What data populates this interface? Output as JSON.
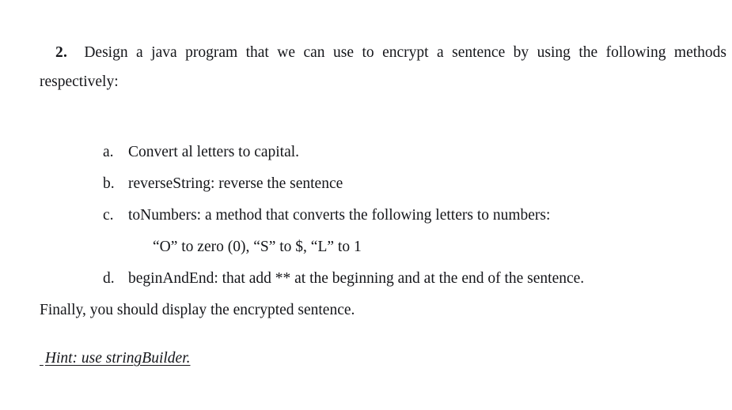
{
  "document": {
    "question_number": "2.",
    "intro": "Design a java program that we can use to encrypt a sentence by using the following methods respectively:",
    "list": [
      {
        "marker": "a.",
        "text": "Convert al letters to capital."
      },
      {
        "marker": "b.",
        "text": "reverseString: reverse the sentence"
      },
      {
        "marker": "c.",
        "text": "toNumbers: a method that converts the following letters to numbers:"
      },
      {
        "marker": "d.",
        "text": "beginAndEnd: that add ** at the beginning and at the end of the sentence."
      }
    ],
    "sub_line": "“O” to zero (0), “S” to $, “L” to 1",
    "closing": "Finally, you should display the encrypted sentence.",
    "hint_leading_space": " ",
    "hint": "Hint: use stringBuilder.",
    "colors": {
      "text": "#15161a",
      "background": "#ffffff"
    }
  }
}
